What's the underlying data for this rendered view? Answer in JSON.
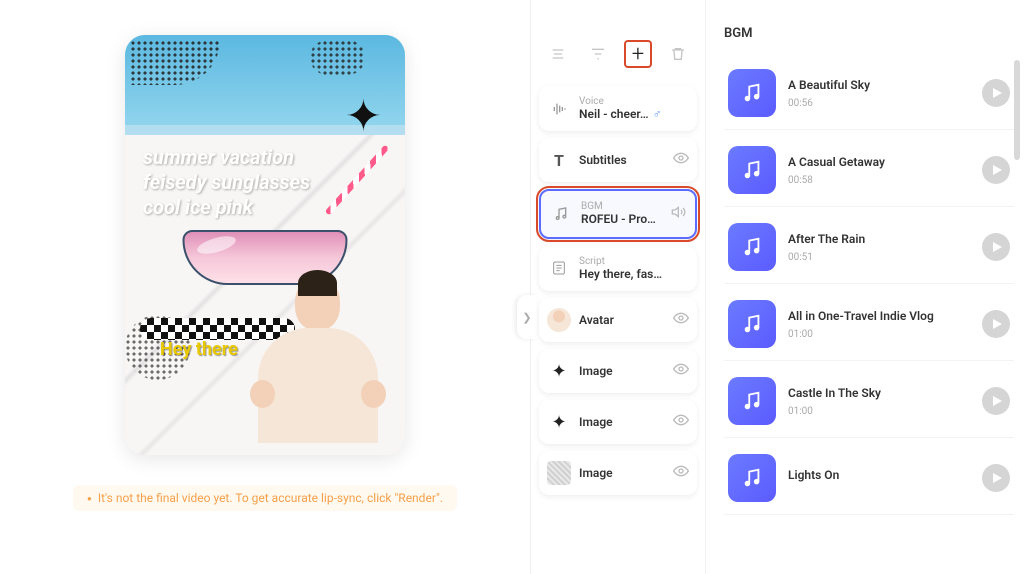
{
  "preview": {
    "overlay_line1": "summer vacation",
    "overlay_line2": "feisedy sunglasses",
    "overlay_line3": "cool ice pink",
    "caption": "Hey there"
  },
  "note": "It's not the final video yet. To get accurate lip-sync, click \"Render\".",
  "layers": {
    "voice": {
      "label": "Voice",
      "value": "Neil - cheer…"
    },
    "subtitles": {
      "value": "Subtitles"
    },
    "bgm": {
      "label": "BGM",
      "value": "ROFEU - Pro…"
    },
    "script": {
      "label": "Script",
      "value": "Hey there, fas…"
    },
    "avatar": {
      "value": "Avatar"
    },
    "image1": {
      "value": "Image"
    },
    "image2": {
      "value": "Image"
    },
    "image3": {
      "value": "Image"
    }
  },
  "right": {
    "title": "BGM",
    "tracks": [
      {
        "name": "A Beautiful Sky",
        "dur": "00:56"
      },
      {
        "name": "A Casual Getaway",
        "dur": "00:58"
      },
      {
        "name": "After The Rain",
        "dur": "00:51"
      },
      {
        "name": "All in One-Travel Indie Vlog",
        "dur": "01:00"
      },
      {
        "name": "Castle In The Sky",
        "dur": "01:00"
      },
      {
        "name": "Lights On",
        "dur": ""
      }
    ]
  }
}
